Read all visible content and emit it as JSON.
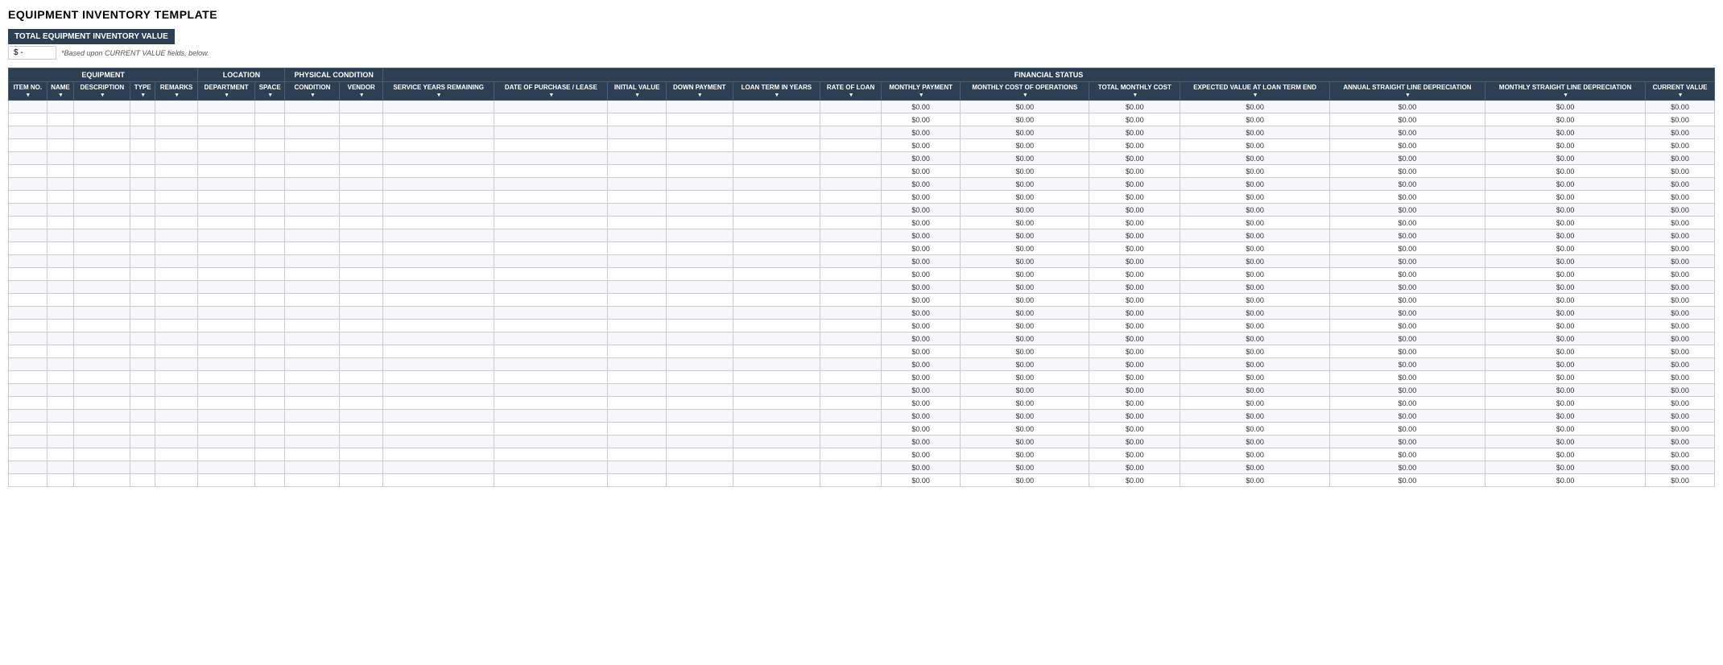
{
  "page": {
    "title": "EQUIPMENT INVENTORY TEMPLATE"
  },
  "summary": {
    "box_label": "TOTAL EQUIPMENT INVENTORY VALUE",
    "value": "$    -",
    "note": "*Based upon CURRENT VALUE fields, below."
  },
  "table": {
    "groups": [
      {
        "label": "EQUIPMENT",
        "colspan": 5
      },
      {
        "label": "LOCATION",
        "colspan": 2
      },
      {
        "label": "PHYSICAL CONDITION",
        "colspan": 2
      },
      {
        "label": "FINANCIAL STATUS",
        "colspan": 12
      }
    ],
    "columns": [
      {
        "label": "ITEM NO.",
        "group": "equipment"
      },
      {
        "label": "NAME",
        "group": "equipment"
      },
      {
        "label": "DESCRIPTION",
        "group": "equipment"
      },
      {
        "label": "TYPE",
        "group": "equipment"
      },
      {
        "label": "REMARKS",
        "group": "equipment"
      },
      {
        "label": "DEPARTMENT",
        "group": "location"
      },
      {
        "label": "SPACE",
        "group": "location"
      },
      {
        "label": "CONDITION",
        "group": "physical"
      },
      {
        "label": "VENDOR",
        "group": "physical"
      },
      {
        "label": "SERVICE YEARS REMAINING",
        "group": "financial"
      },
      {
        "label": "DATE OF PURCHASE / LEASE",
        "group": "financial"
      },
      {
        "label": "INITIAL VALUE",
        "group": "financial"
      },
      {
        "label": "DOWN PAYMENT",
        "group": "financial"
      },
      {
        "label": "LOAN TERM IN YEARS",
        "group": "financial"
      },
      {
        "label": "RATE OF LOAN",
        "group": "financial"
      },
      {
        "label": "MONTHLY PAYMENT",
        "group": "financial"
      },
      {
        "label": "MONTHLY COST OF OPERATIONS",
        "group": "financial"
      },
      {
        "label": "TOTAL MONTHLY COST",
        "group": "financial"
      },
      {
        "label": "EXPECTED VALUE AT LOAN TERM END",
        "group": "financial"
      },
      {
        "label": "ANNUAL STRAIGHT LINE DEPRECIATION",
        "group": "financial"
      },
      {
        "label": "MONTHLY STRAIGHT LINE DEPRECIATION",
        "group": "financial"
      },
      {
        "label": "CURRENT VALUE",
        "group": "financial"
      }
    ],
    "empty_value": "$0.00",
    "num_rows": 30
  }
}
